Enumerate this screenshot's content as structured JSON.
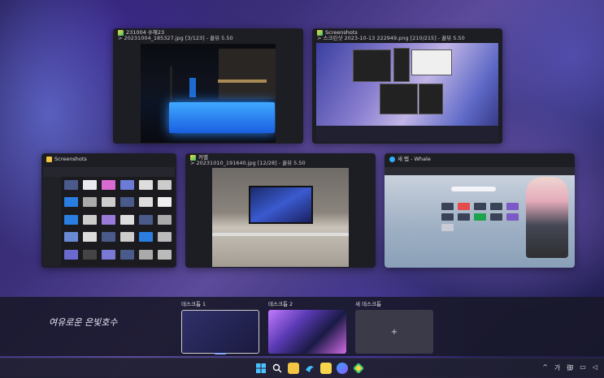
{
  "windows": {
    "photo1": {
      "title": "231004 수해23",
      "subtitle": "> 20231004_185327.jpg [3/123] - 꿀뷰 5.50",
      "icon": "honeyview-icon"
    },
    "screens": {
      "title": "Screenshots",
      "subtitle": "> 스크린샷 2023-10-13 222949.png [210/215] - 꿀뷰 5.50",
      "icon": "honeyview-icon"
    },
    "explorer": {
      "title": "Screenshots",
      "icon": "folder-icon"
    },
    "photo2": {
      "title": "카멜",
      "subtitle": "> 20231010_191640.jpg [12/28] - 꿀뷰 5.50",
      "icon": "honeyview-icon"
    },
    "whale": {
      "title": "새 탭 - Whale",
      "icon": "whale-icon"
    }
  },
  "signature": "여유로운 은빛호수",
  "desktops": [
    {
      "label": "데스크톱 1"
    },
    {
      "label": "데스크톱 2"
    },
    {
      "label": "새 데스크톱",
      "plus": "+"
    }
  ],
  "taskbar": {
    "icons": [
      "windows-start-icon",
      "search-icon",
      "file-explorer-icon",
      "whale-browser-icon",
      "sticky-notes-icon",
      "messenger-icon",
      "honeyview-icon"
    ],
    "tray": {
      "chevron": "^",
      "ime1": "가",
      "ime2": "御",
      "display": "▭",
      "volume": "◁"
    }
  },
  "colors": {
    "accent": "#8aa8ff",
    "pool": "#2f8cff"
  }
}
